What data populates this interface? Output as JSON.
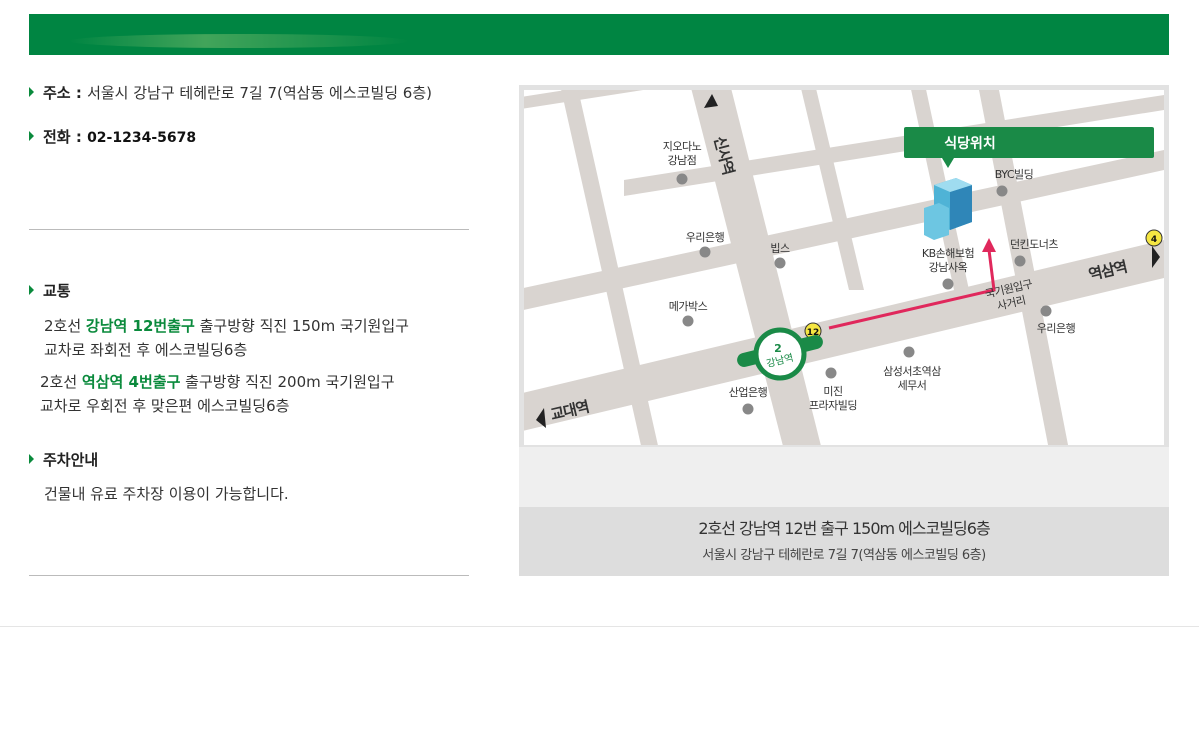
{
  "info": {
    "address_label": "주소",
    "address_value": "서울시 강남구 테헤란로 7길 7(역삼동 에스코빌딩 6층)",
    "phone_label": "전화",
    "phone_value": "02-1234-5678"
  },
  "transport": {
    "title": "교통",
    "route1_prefix": "2호선 ",
    "route1_station": "강남역 12번출구",
    "route1_line1": " 출구방향 직진 150m 국기원입구",
    "route1_line2": "교차로 좌회전 후 에스코빌딩6층",
    "route2_prefix": "2호선 ",
    "route2_station": "역삼역 4번출구",
    "route2_line1": " 출구방향 직진 200m 국기원입구",
    "route2_line2": "교차로 우회전 후 맞은편 에스코빌딩6층"
  },
  "parking": {
    "title": "주차안내",
    "text": "건물내 유료 주차장 이용이 가능합니다."
  },
  "map": {
    "restaurant_badge": "식당위치",
    "station_gangnam_line": "2",
    "station_gangnam_name": "강남역",
    "exit_gangnam": "12",
    "exit_yeoksam": "4",
    "roads": {
      "sinsa": "신사역",
      "gyodae": "교대역",
      "yeoksam": "역삼역"
    },
    "intersection": [
      "국기원입구",
      "사거리"
    ],
    "places": {
      "giordano": [
        "지오다노",
        "강남점"
      ],
      "woori1": "우리은행",
      "bips": "빕스",
      "megabox": "메가박스",
      "kb": [
        "KB손해보험",
        "강남사옥"
      ],
      "byc": "BYC빌딩",
      "dunkin": "던킨도너츠",
      "woori2": "우리은행",
      "samsung_tax": [
        "삼성서초역삼",
        "세무서"
      ],
      "mijin": [
        "미진",
        "프라자빌딩"
      ],
      "kdb": "산업은행"
    },
    "caption_main": "2호선 강남역 12번 출구 150m 에스코빌딩6층",
    "caption_sub": "서울시 강남구 테헤란로 7길 7(역삼동 에스코빌딩 6층)"
  },
  "colors": {
    "brand_green": "#008542",
    "route_pink": "#e0285c",
    "exit_yellow": "#f5e642",
    "road_gray": "#d9d4d0"
  }
}
